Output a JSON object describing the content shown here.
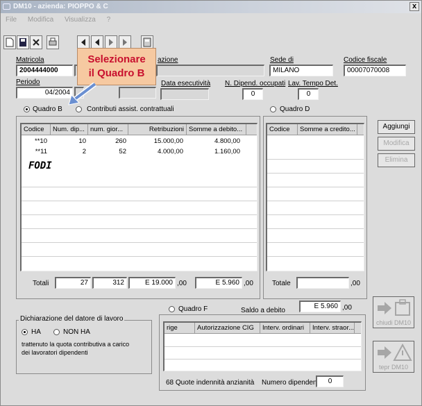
{
  "window": {
    "title": "DM10 - azienda: PIOPPO & C",
    "close_label": "x"
  },
  "menu": [
    "File",
    "Modifica",
    "Visualizza",
    "?"
  ],
  "callout": {
    "line1": "Selezionare",
    "line2": "il Quadro B"
  },
  "header": {
    "matricola_label": "Matricola",
    "matricola_value": "2004444000",
    "ragione_label_partial": "azione",
    "sede_label": "Sede di",
    "sede_value": "MILANO",
    "codice_fiscale_label": "Codice fiscale",
    "codice_fiscale_value": "00007070008",
    "periodo_label": "Periodo",
    "periodo_value": "04/2004",
    "data_esecutivita_label": "Data esecutività",
    "dipendenti_label": "N. Dipend. occupati",
    "dipendenti_value": "0",
    "lav_tempo_det_label": "Lav. Tempo Det.",
    "lav_tempo_det_value": "0"
  },
  "quadro_options": {
    "b_label": "Quadro B",
    "contributi_label": "Contributi assist. contrattuali",
    "d_label": "Quadro D"
  },
  "table_b": {
    "columns": [
      "Codice",
      "Num. dip...",
      "num. gior...",
      "Retribuzioni",
      "Somme a debito..."
    ],
    "rows": [
      [
        "**10",
        "10",
        "260",
        "15.000,00",
        "4.800,00"
      ],
      [
        "**11",
        "2",
        "52",
        "4.000,00",
        "1.160,00"
      ]
    ],
    "annotation": "FODI"
  },
  "table_d": {
    "columns": [
      "Codice",
      "Somme a credito..."
    ]
  },
  "totals": {
    "label": "Totali",
    "num_dip": "27",
    "num_gior": "312",
    "retribuzioni": "E 19.000",
    "retribuzioni_suffix": ",00",
    "somme_debito": "E 5.960",
    "somme_debito_suffix": ",00",
    "totale_label": "Totale",
    "totale_suffix": ",00"
  },
  "side_buttons": {
    "add": "Aggiungi",
    "edit": "Modifica",
    "delete": "Elimina"
  },
  "quadro_f": {
    "label": "Quadro F"
  },
  "saldo": {
    "label": "Saldo a debito",
    "value": "E 5.960",
    "suffix": ",00"
  },
  "dichiarazione": {
    "title": "Dichiarazione del datore di lavoro",
    "ha_label": "HA",
    "non_ha_label": "NON HA",
    "text_line1": "trattenuto la quota contributiva a carico",
    "text_line2": "dei lavoratori dipendenti"
  },
  "table_f": {
    "columns": [
      "rige",
      "Autorizzazione CIG",
      "Interv. ordinari",
      "Interv. straor..."
    ]
  },
  "footer": {
    "quote_label": "68 Quote indennità anzianità",
    "numero_label": "Numero dipendenti",
    "numero_value": "0"
  },
  "big_buttons": {
    "close": "chiudi DM10",
    "print": "tepr DM10"
  }
}
